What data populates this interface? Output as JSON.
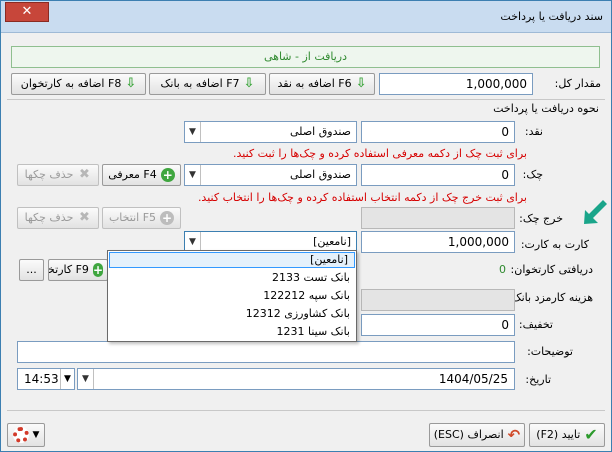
{
  "window": {
    "title": "سند دریافت یا پرداخت",
    "close_glyph": "✕"
  },
  "header": {
    "subtitle": "دریافت از - شاهی"
  },
  "amount": {
    "label": "مقدار کل:",
    "value": "1,000,000"
  },
  "add_buttons": {
    "cash": "اضافه به نقد F6",
    "bank": "اضافه به بانک F7",
    "card": "اضافه به کارتخوان F8"
  },
  "method": {
    "title": "نحوه دریافت یا پرداخت"
  },
  "cash": {
    "label": "نقد:",
    "value": "0",
    "box": "صندوق اصلی"
  },
  "cheque": {
    "note": "برای ثبت چک از دکمه معرفی استفاده کرده و چک‌ها را ثبت کنید.",
    "label": "چک:",
    "value": "0",
    "box": "صندوق اصلی",
    "introduce_button": "معرفی F4",
    "delete_button": "حذف چکها"
  },
  "cheque_out": {
    "note": "برای ثبت خرج چک از دکمه انتخاب استفاده کرده و چک‌ها را انتخاب کنید.",
    "label": "خرج چک:",
    "select_button": "انتخاب F5",
    "delete_button": "حذف چکها"
  },
  "card_transfer": {
    "label": "کارت به کارت:",
    "value": "1,000,000",
    "selected": "[نامعین]"
  },
  "dropdown": {
    "options": [
      "[نامعین]",
      "بانک تست 2133",
      "بانک سپه 122212",
      "بانک کشاورزی 12312",
      "بانک سینا 1231"
    ]
  },
  "pos": {
    "label": "دریافتی کارتخوان:",
    "value": "0",
    "button": "کارتخوان F9",
    "more": "..."
  },
  "bank_fee": {
    "label": "هزینه کارمزد بانک:"
  },
  "discount": {
    "label": "تخفیف:",
    "value": "0"
  },
  "description": {
    "label": "توضیحات:"
  },
  "date": {
    "label": "تاریخ:",
    "value": "1404/05/25",
    "time": "14:53"
  },
  "footer": {
    "ok": "(F2) تایید",
    "cancel": "(ESC) انصراف"
  },
  "colors": {
    "accent_red": "#d60000",
    "accent_green": "#2f8a2f",
    "title_bg": "#c9dcf0"
  }
}
